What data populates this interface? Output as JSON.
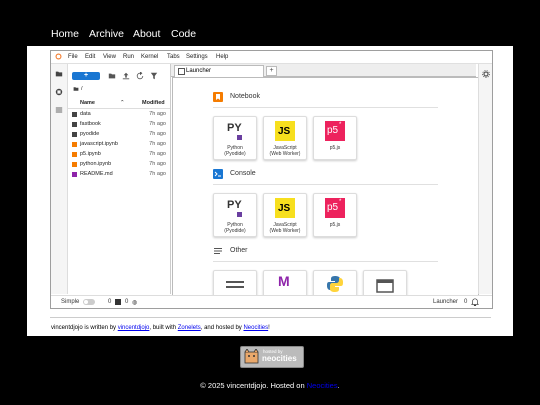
{
  "nav": {
    "home": "Home",
    "archive": "Archive",
    "about": "About",
    "code": "Code"
  },
  "menu": [
    "File",
    "Edit",
    "View",
    "Run",
    "Kernel",
    "Tabs",
    "Settings",
    "Help"
  ],
  "filebrowser": {
    "new_label": "+",
    "path": "/",
    "col_name": "Name",
    "col_modified": "Modified",
    "files": [
      {
        "name": "data",
        "modified": "7h ago",
        "type": "folder"
      },
      {
        "name": "fastbook",
        "modified": "7h ago",
        "type": "folder"
      },
      {
        "name": "pyodide",
        "modified": "7h ago",
        "type": "folder"
      },
      {
        "name": "javascript.ipynb",
        "modified": "7h ago",
        "type": "notebook"
      },
      {
        "name": "p5.ipynb",
        "modified": "7h ago",
        "type": "notebook"
      },
      {
        "name": "python.ipynb",
        "modified": "7h ago",
        "type": "notebook"
      },
      {
        "name": "README.md",
        "modified": "7h ago",
        "type": "markdown"
      }
    ]
  },
  "tab": {
    "label": "Launcher",
    "add_label": "+"
  },
  "launcher": {
    "notebook": {
      "title": "Notebook",
      "cards": [
        "Python\n(Pyodide)",
        "JavaScript\n(Web Worker)",
        "p5.js"
      ]
    },
    "console": {
      "title": "Console",
      "cards": [
        "Python\n(Pyodide)",
        "JavaScript\n(Web Worker)",
        "p5.js"
      ]
    },
    "other": {
      "title": "Other"
    },
    "logo_text": {
      "py": "PY",
      "js": "JS",
      "p5": "p5",
      "p5_star": "*",
      "markdown": "M"
    }
  },
  "status": {
    "mode": "Simple",
    "count1": "0",
    "count2": "0",
    "right": "Launcher",
    "right_count": "0"
  },
  "credits": {
    "prefix": "vincentdjojo is written by ",
    "author": "vincentdjojo",
    "mid": ", built with ",
    "tool": "Zonelets",
    "mid2": ", and hosted by ",
    "host": "Neocities",
    "suffix": "!"
  },
  "badge": {
    "line1": "hosted by",
    "line2": "neocities"
  },
  "footer": {
    "text": "© 2025 vincentdjojo. Hosted on ",
    "link": "Neocities",
    "suffix": "."
  },
  "colors": {
    "accent": "#1976d2",
    "js_yellow": "#f7df1e",
    "p5_pink": "#ed225d",
    "notebook_orange": "#f57c00",
    "markdown_purple": "#8e24aa"
  }
}
